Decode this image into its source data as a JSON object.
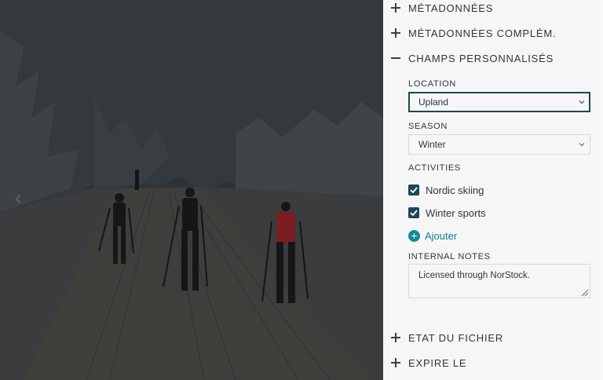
{
  "viewer": {
    "prev_icon": "chevron-left-icon"
  },
  "sidebar": {
    "sections": {
      "metadata": {
        "title": "MÉTADONNÉES",
        "expanded": false
      },
      "extra_metadata": {
        "title": "MÉTADONNÉES COMPLÉM.",
        "expanded": false
      },
      "custom_fields": {
        "title": "CHAMPS PERSONNALISÉS",
        "expanded": true
      },
      "file_status": {
        "title": "ETAT DU FICHIER",
        "expanded": false
      },
      "expires": {
        "title": "EXPIRE LE",
        "expanded": false
      }
    },
    "custom_fields": {
      "location": {
        "label": "LOCATION",
        "value": "Upland"
      },
      "season": {
        "label": "SEASON",
        "value": "Winter"
      },
      "activities": {
        "label": "ACTIVITIES",
        "items": [
          {
            "label": "Nordic skiing",
            "checked": true
          },
          {
            "label": "Winter sports",
            "checked": true
          }
        ],
        "add_label": "Ajouter"
      },
      "internal_notes": {
        "label": "INTERNAL NOTES",
        "value": "Licensed through NorStock."
      }
    }
  },
  "colors": {
    "accent_dark": "#1e4754",
    "accent_link": "#0f8a97",
    "panel_bg": "#f6f6f6",
    "text": "#30353a"
  }
}
